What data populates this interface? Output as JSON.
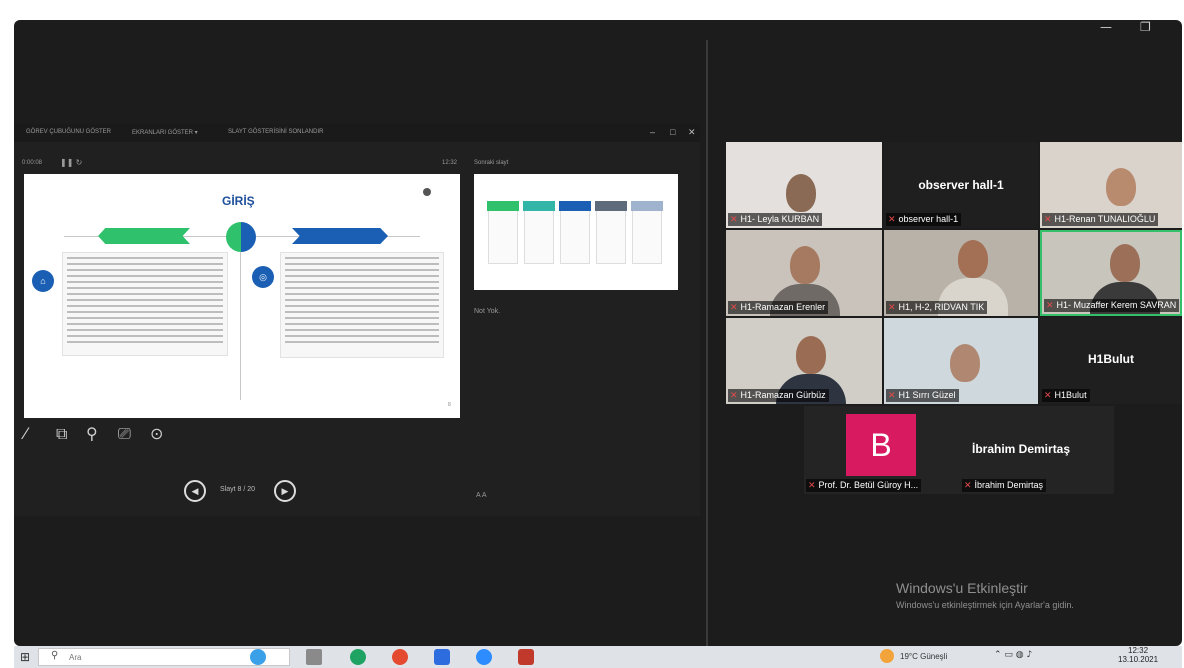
{
  "window": {
    "minimize_glyph": "—",
    "restore_glyph": "❐"
  },
  "presenter": {
    "menu": [
      "GÖREV ÇUBUĞUNU GÖSTER",
      "EKRANLARI GÖSTER ▾",
      "SLAYT GÖSTERİSİNİ SONLANDIR"
    ],
    "window_controls": [
      "–",
      "□",
      "✕"
    ],
    "timer": "0:00:08",
    "timer_controls": "❚❚ ↻",
    "clock": "12:32",
    "slide": {
      "title": "GİRİŞ",
      "left_icon": "⌂",
      "right_icon": "◎",
      "page_marker": "8"
    },
    "tools": [
      "pen-icon",
      "laser-pointer-icon",
      "zoom-icon",
      "presenter-view-icon",
      "more-options-icon"
    ],
    "navigation": {
      "prev_glyph": "◀",
      "next_glyph": "▶",
      "counter": "Slayt 8 / 20"
    },
    "next_slide_label": "Sonraki slayt",
    "notes_text": "Not Yok.",
    "notes_font_controls": "A  A"
  },
  "participants": [
    {
      "name": "H1- Leyla KURBAN"
    },
    {
      "name": "observer hall-1",
      "display": "observer hall-1"
    },
    {
      "name": "H1-Renan TUNALIOĞLU"
    },
    {
      "name": "H1-Ramazan Erenler"
    },
    {
      "name": "H1, H-2, RIDVAN TIK"
    },
    {
      "name": "H1- Muzaffer Kerem SAVRAN",
      "active_speaker": true
    },
    {
      "name": "H1-Ramazan Gürbüz"
    },
    {
      "name": "H1 Sırrı Güzel"
    },
    {
      "name": "H1Bulut",
      "display": "H1Bulut"
    }
  ],
  "bottom_tile": {
    "avatar_letter": "B",
    "avatar_color": "#d81b60",
    "left_name": "Prof. Dr. Betül Güroy  H...",
    "right_display": "İbrahim Demirtaş",
    "right_name": "İbrahim Demirtaş"
  },
  "watermark": {
    "title": "Windows'u Etkinleştir",
    "subtitle": "Windows'u etkinleştirmek için Ayarlar'a gidin."
  },
  "taskbar": {
    "start_glyph": "⊞",
    "search_placeholder": "Ara",
    "temperature": "19°C  Güneşli",
    "tray_glyphs": "⌃ ▭ ◍ ♪",
    "time": "12:32",
    "date": "13.10.2021"
  },
  "colors": {
    "accent_green": "#34c06b",
    "mic_muted": "#e64a4a",
    "slide_blue": "#1a5fb4",
    "slide_green": "#2fc16b"
  }
}
